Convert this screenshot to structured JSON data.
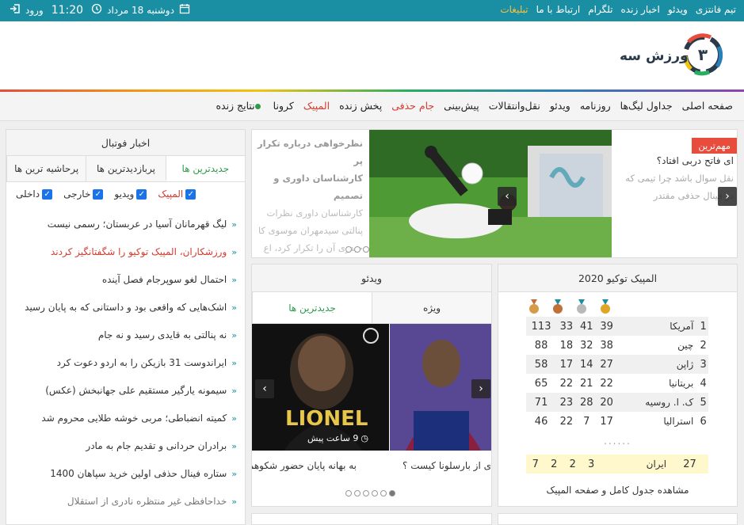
{
  "topbar": {
    "links": [
      "تیم فانتزی",
      "ویدئو",
      "اخبار زنده",
      "تلگرام",
      "ارتباط با ما",
      "تبلیغات"
    ],
    "date": "دوشنبه 18 مرداد",
    "time": "11:20",
    "login": "ورود"
  },
  "logo": {
    "text": "ورزش سه",
    "mark": "۳"
  },
  "nav": {
    "items": [
      {
        "label": "صفحه اصلی",
        "red": false
      },
      {
        "label": "جداول لیگ‌ها",
        "red": false
      },
      {
        "label": "روزنامه",
        "red": false
      },
      {
        "label": "ویدئو",
        "red": false
      },
      {
        "label": "نقل‌وانتقالات",
        "red": false
      },
      {
        "label": "پیش‌بینی",
        "red": false
      },
      {
        "label": "جام حذفی",
        "red": true
      },
      {
        "label": "پخش زنده",
        "red": false
      },
      {
        "label": "المپیک",
        "red": true
      },
      {
        "label": "کرونا",
        "red": false
      },
      {
        "label": "نتایج زنده",
        "red": false
      }
    ]
  },
  "football": {
    "title": "اخبار فوتبال",
    "tabs": [
      "جدیدترین ها",
      "پربازدیدترین ها",
      "پرحاشیه ترین ها"
    ],
    "filters": [
      {
        "label": "داخلی",
        "red": false
      },
      {
        "label": "خارجی",
        "red": false
      },
      {
        "label": "ویدیو",
        "red": false
      },
      {
        "label": "المپیک",
        "red": true
      }
    ],
    "news": [
      {
        "text": "لیگ قهرمانان آسیا در عربستان؛ رسمی نیست",
        "style": ""
      },
      {
        "text": "ورزشکاران، المپیک توکیو را شگفتانگیز کردند",
        "style": "red"
      },
      {
        "text": "احتمال لغو سوپرجام فصل آینده",
        "style": ""
      },
      {
        "text": "اشک‌هایی که واقعی بود و داستانی که به پایان رسید",
        "style": ""
      },
      {
        "text": "نه پنالتی به قایدی رسید و نه جام",
        "style": ""
      },
      {
        "text": "ایراندوست 31 بازیکن را به اردو دعوت کرد",
        "style": ""
      },
      {
        "text": "سیمونه یارگیر مستقیم علی جهانبخش (عکس)",
        "style": ""
      },
      {
        "text": "کمیته انضباطی؛ مربی خوشه طلایی محروم شد",
        "style": ""
      },
      {
        "text": "برادران حردانی و تقدیم جام به مادر",
        "style": ""
      },
      {
        "text": "ستاره فینال حذفی اولین خرید سپاهان 1400",
        "style": ""
      },
      {
        "text": "خداحافظی غیر منتظره نادری از استقلال",
        "style": "grey"
      }
    ]
  },
  "slider": {
    "badge": "مهم‌ترین",
    "right_q1": "ای فاتح دربی افتاد؟",
    "right_q2": "نقل سوال باشد چرا تیمی که در فینال حذفی مقتدر",
    "left_lines": [
      "نظرخواهی درباره تکرار پر",
      "کارشناسان داوری و تصمیم",
      "کارشناسان داوری نظرات",
      "پنالتی سیدمهران موسوی کا",
      "حیدری آن را تکرار کرد، اع"
    ]
  },
  "video": {
    "title": "ویدئو",
    "tabs": [
      "ویژه",
      "جدیدترین ها"
    ],
    "thumb_text": "LIONEL",
    "time_ago": "9 ساعت پیش",
    "captions": [
      "به بهانه پایان حضور شکوهم",
      "ی از بارسلونا کیست ؟"
    ]
  },
  "olympic": {
    "title": "المپیک توکیو 2020",
    "medal_colors": [
      "#e0a526",
      "#b9b9b9",
      "#c2703a",
      "#d79a4a"
    ],
    "rows": [
      {
        "rank": "1",
        "name": "آمریکا",
        "gold": "39",
        "silver": "41",
        "bronze": "33",
        "total": "113"
      },
      {
        "rank": "2",
        "name": "چین",
        "gold": "38",
        "silver": "32",
        "bronze": "18",
        "total": "88"
      },
      {
        "rank": "3",
        "name": "ژاپن",
        "gold": "27",
        "silver": "14",
        "bronze": "17",
        "total": "58"
      },
      {
        "rank": "4",
        "name": "بریتانیا",
        "gold": "22",
        "silver": "21",
        "bronze": "22",
        "total": "65"
      },
      {
        "rank": "5",
        "name": "ک. ا. روسیه",
        "gold": "20",
        "silver": "28",
        "bronze": "23",
        "total": "71"
      },
      {
        "rank": "6",
        "name": "استرالیا",
        "gold": "17",
        "silver": "7",
        "bronze": "22",
        "total": "46"
      }
    ],
    "ellipsis": "......",
    "iran": {
      "rank": "27",
      "name": "ایران",
      "gold": "3",
      "silver": "2",
      "bronze": "2",
      "total": "7"
    },
    "link": "مشاهده جدول کامل و صفحه المپیک"
  }
}
